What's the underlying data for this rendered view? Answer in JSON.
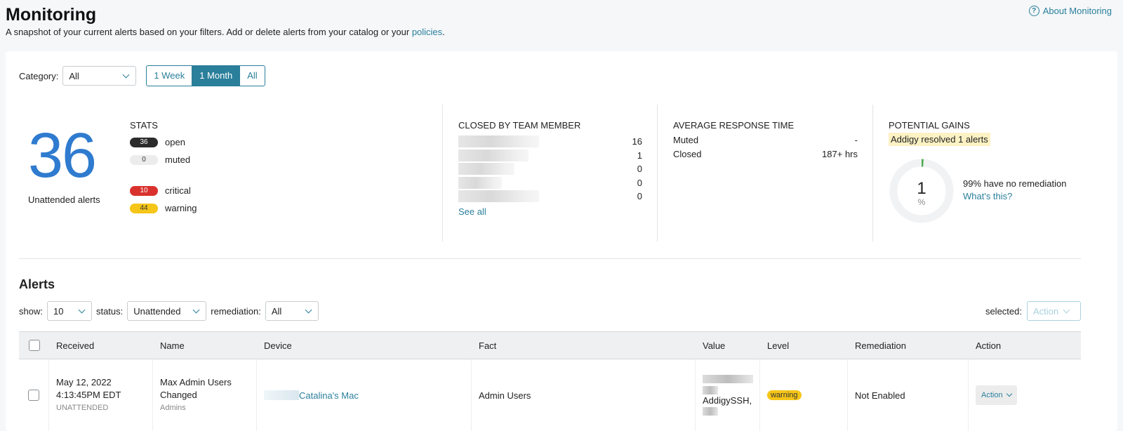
{
  "header": {
    "title": "Monitoring",
    "subtitle": "A snapshot of your current alerts based on your filters. Add or delete alerts from your catalog or your",
    "policies_link": "policies",
    "period": ".",
    "about_label": "About Monitoring"
  },
  "filters": {
    "category_label": "Category:",
    "category_value": "All",
    "ranges": [
      "1 Week",
      "1 Month",
      "All"
    ],
    "active_range": "1 Month"
  },
  "summary": {
    "unattended_count": "36",
    "unattended_label": "Unattended alerts",
    "stats_title": "STATS",
    "stats": [
      {
        "count": "36",
        "label": "open",
        "color": "#2b2b2b"
      },
      {
        "count": "0",
        "label": "muted",
        "color": "#ececec"
      },
      {
        "count": "10",
        "label": "critical",
        "color": "#d9322e"
      },
      {
        "count": "44",
        "label": "warning",
        "color": "#f5c518"
      }
    ]
  },
  "team": {
    "title": "CLOSED BY TEAM MEMBER",
    "counts": [
      "16",
      "1",
      "0",
      "0",
      "0"
    ],
    "see_all": "See all"
  },
  "response": {
    "title": "AVERAGE RESPONSE TIME",
    "rows": [
      {
        "label": "Muted",
        "value": "-"
      },
      {
        "label": "Closed",
        "value": "187+ hrs"
      }
    ]
  },
  "gains": {
    "title": "POTENTIAL GAINS",
    "highlight": "Addigy resolved 1 alerts",
    "percent": "1",
    "percent_symbol": "%",
    "percent_fraction": 0.01,
    "no_remediation": "99% have no remediation",
    "whats_this": "What's this?"
  },
  "alerts": {
    "title": "Alerts",
    "show_label": "show:",
    "show_value": "10",
    "status_label": "status:",
    "status_value": "Unattended",
    "remediation_label": "remediation:",
    "remediation_value": "All",
    "selected_label": "selected:",
    "action_label": "Action",
    "columns": [
      "Received",
      "Name",
      "Device",
      "Fact",
      "Value",
      "Level",
      "Remediation",
      "Action"
    ],
    "rows": [
      {
        "date": "May 12, 2022",
        "time": "4:13:45PM EDT",
        "state": "UNATTENDED",
        "name": "Max Admin Users Changed",
        "category": "Admins",
        "device": "Catalina's Mac",
        "fact": "Admin Users",
        "value": "AddigySSH,",
        "level": "warning",
        "remediation": "Not Enabled",
        "action": "Action"
      }
    ]
  }
}
